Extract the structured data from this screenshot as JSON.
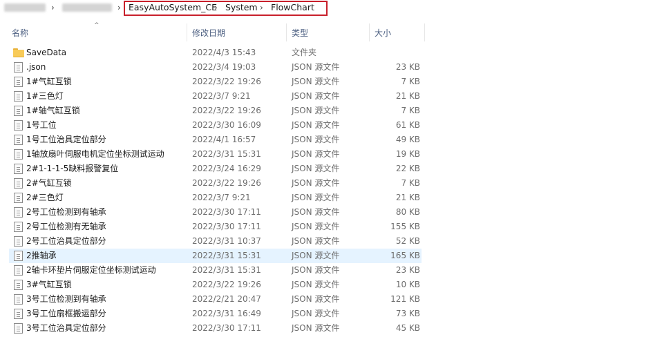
{
  "breadcrumb": {
    "separator": "›",
    "items": [
      "EasyAutoSystem_CE",
      "System",
      "FlowChart"
    ]
  },
  "columns": {
    "name": "名称",
    "date": "修改日期",
    "type": "类型",
    "size": "大小",
    "sort_indicator": "^"
  },
  "selected_row_index": 14,
  "colors": {
    "selection": "#e5f3ff",
    "highlight_border": "#c8202b",
    "folder": "#f8cb59"
  },
  "rows": [
    {
      "icon": "folder-icon",
      "name": "SaveData",
      "date": "2022/4/3 15:43",
      "type": "文件夹",
      "size": ""
    },
    {
      "icon": "file-icon",
      "name": ".json",
      "date": "2022/3/4 19:03",
      "type": "JSON 源文件",
      "size": "23 KB"
    },
    {
      "icon": "file-icon",
      "name": "1#气缸互锁",
      "date": "2022/3/22 19:26",
      "type": "JSON 源文件",
      "size": "7 KB"
    },
    {
      "icon": "file-icon",
      "name": "1#三色灯",
      "date": "2022/3/7 9:21",
      "type": "JSON 源文件",
      "size": "21 KB"
    },
    {
      "icon": "file-icon",
      "name": "1#轴气缸互锁",
      "date": "2022/3/22 19:26",
      "type": "JSON 源文件",
      "size": "7 KB"
    },
    {
      "icon": "file-icon",
      "name": "1号工位",
      "date": "2022/3/30 16:09",
      "type": "JSON 源文件",
      "size": "61 KB"
    },
    {
      "icon": "file-icon",
      "name": "1号工位治具定位部分",
      "date": "2022/4/1 16:57",
      "type": "JSON 源文件",
      "size": "49 KB"
    },
    {
      "icon": "file-icon",
      "name": "1轴放扇叶伺服电机定位坐标测试运动",
      "date": "2022/3/31 15:31",
      "type": "JSON 源文件",
      "size": "19 KB"
    },
    {
      "icon": "file-icon",
      "name": "2#1-1-1-5缺料报警复位",
      "date": "2022/3/24 16:29",
      "type": "JSON 源文件",
      "size": "22 KB"
    },
    {
      "icon": "file-icon",
      "name": "2#气缸互锁",
      "date": "2022/3/22 19:26",
      "type": "JSON 源文件",
      "size": "7 KB"
    },
    {
      "icon": "file-icon",
      "name": "2#三色灯",
      "date": "2022/3/7 9:21",
      "type": "JSON 源文件",
      "size": "21 KB"
    },
    {
      "icon": "file-icon",
      "name": "2号工位检测到有轴承",
      "date": "2022/3/30 17:11",
      "type": "JSON 源文件",
      "size": "80 KB"
    },
    {
      "icon": "file-icon",
      "name": "2号工位检测有无轴承",
      "date": "2022/3/30 17:11",
      "type": "JSON 源文件",
      "size": "155 KB"
    },
    {
      "icon": "file-icon",
      "name": "2号工位治具定位部分",
      "date": "2022/3/31 10:37",
      "type": "JSON 源文件",
      "size": "52 KB"
    },
    {
      "icon": "file-icon",
      "name": "2推轴承",
      "date": "2022/3/31 15:31",
      "type": "JSON 源文件",
      "size": "165 KB"
    },
    {
      "icon": "file-icon",
      "name": "2轴卡环垫片伺服定位坐标测试运动",
      "date": "2022/3/31 15:31",
      "type": "JSON 源文件",
      "size": "23 KB"
    },
    {
      "icon": "file-icon",
      "name": "3#气缸互锁",
      "date": "2022/3/22 19:26",
      "type": "JSON 源文件",
      "size": "10 KB"
    },
    {
      "icon": "file-icon",
      "name": "3号工位检测到有轴承",
      "date": "2022/2/21 20:47",
      "type": "JSON 源文件",
      "size": "121 KB"
    },
    {
      "icon": "file-icon",
      "name": "3号工位扇框搬运部分",
      "date": "2022/3/31 16:49",
      "type": "JSON 源文件",
      "size": "73 KB"
    },
    {
      "icon": "file-icon",
      "name": "3号工位治具定位部分",
      "date": "2022/3/30 17:11",
      "type": "JSON 源文件",
      "size": "45 KB"
    }
  ]
}
